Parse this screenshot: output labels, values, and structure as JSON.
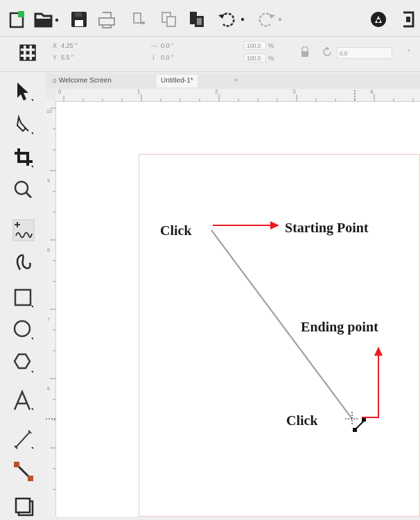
{
  "toolbar": {
    "buttons": [
      {
        "name": "new-document-icon"
      },
      {
        "name": "open-folder-icon"
      },
      {
        "name": "save-icon"
      },
      {
        "name": "print-icon"
      },
      {
        "name": "cut-icon"
      },
      {
        "name": "copy-icon"
      },
      {
        "name": "paste-icon"
      },
      {
        "name": "undo-icon"
      },
      {
        "name": "redo-icon"
      },
      {
        "name": "search-content-icon"
      },
      {
        "name": "import-icon"
      }
    ]
  },
  "property_bar": {
    "width": "4.25 \"",
    "height": "5.5 \"",
    "x": "0.0 \"",
    "y": "0.0 \"",
    "scale_w": "100.0",
    "scale_h": "100.0",
    "scale_unit": "%",
    "rotation": "0.0",
    "rotation_unit": "°"
  },
  "tabs": {
    "welcome": "Welcome Screen",
    "document": "Untitled-1*",
    "add": "+"
  },
  "ruler": {
    "ticks_h": [
      "0",
      "1",
      "2",
      "3",
      "4"
    ],
    "ticks_v": [
      "10",
      "9",
      "8",
      "7",
      "6"
    ]
  },
  "tools": [
    {
      "name": "pick-tool-icon"
    },
    {
      "name": "shape-tool-icon"
    },
    {
      "name": "crop-tool-icon"
    },
    {
      "name": "zoom-tool-icon"
    },
    {
      "name": "freehand-tool-icon"
    },
    {
      "name": "artistic-media-tool-icon"
    },
    {
      "name": "rectangle-tool-icon"
    },
    {
      "name": "ellipse-tool-icon"
    },
    {
      "name": "polygon-tool-icon"
    },
    {
      "name": "text-tool-icon"
    },
    {
      "name": "parallel-dimension-tool-icon"
    },
    {
      "name": "connector-tool-icon"
    },
    {
      "name": "drop-shadow-tool-icon"
    }
  ],
  "annotations": {
    "click_start": "Click",
    "starting_point": "Starting Point",
    "ending_point": "Ending point",
    "click_end": "Click"
  },
  "colors": {
    "arrow": "#e81c24",
    "line": "#a0a0a0",
    "page_border": "#e9c9c5",
    "new_doc_green": "#2fb94a"
  }
}
